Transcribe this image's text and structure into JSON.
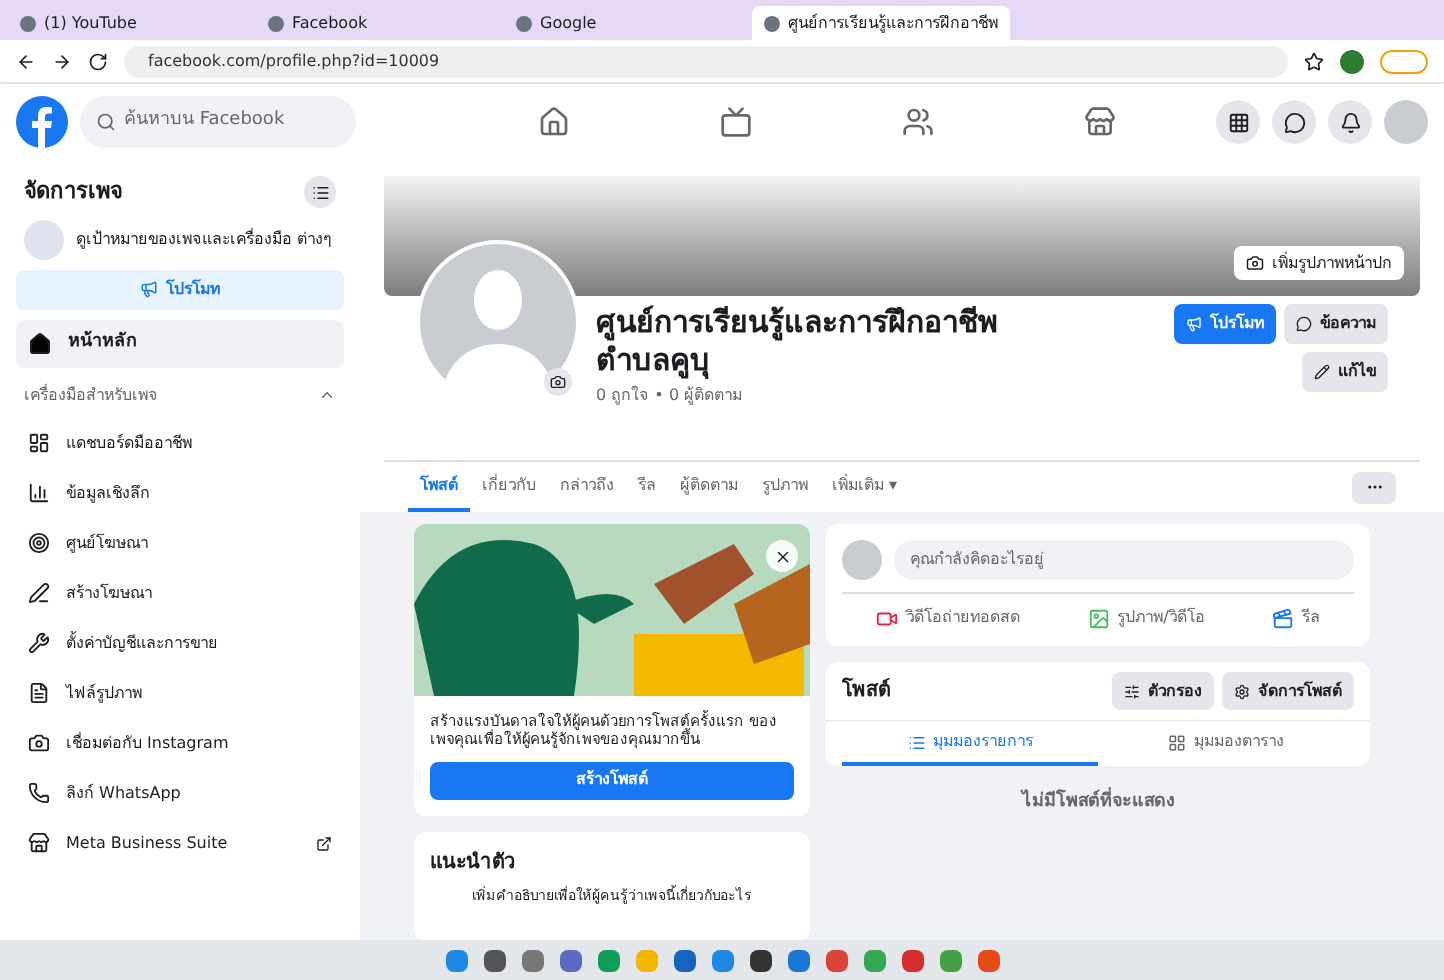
{
  "browser": {
    "tabs": [
      {
        "title": "(1) YouTube",
        "selected": false
      },
      {
        "title": "Facebook",
        "selected": false
      },
      {
        "title": "Google",
        "selected": false
      },
      {
        "title": "ศูนย์การเรียนรู้และการฝึกอาชีพ",
        "selected": true
      }
    ],
    "url": "facebook.com/profile.php?id=10009"
  },
  "fb_header": {
    "search_placeholder": "ค้นหาบน Facebook"
  },
  "sidebar": {
    "title": "จัดการเพจ",
    "page_hint": "ดูเป้าหมายของเพจและเครื่องมือ ต่างๆ",
    "promote_button": "โปรโมท",
    "home": {
      "label": "หน้าหลัก",
      "selected": true
    },
    "section": {
      "title": "เครื่องมือสำหรับเพจ",
      "expanded": true,
      "items": [
        {
          "label": "แดชบอร์ดมืออาชีพ",
          "kind": "dashboard"
        },
        {
          "label": "ข้อมูลเชิงลึก",
          "kind": "insights"
        },
        {
          "label": "ศูนย์โฆษณา",
          "kind": "ads"
        },
        {
          "label": "สร้างโฆษณา",
          "kind": "create"
        },
        {
          "label": "ตั้งค่าบัญชีและการขาย",
          "kind": "tools"
        },
        {
          "label": "ไฟล์รูปภาพ",
          "kind": "files"
        },
        {
          "label": "เชื่อมต่อกับ Instagram",
          "kind": "instagram"
        },
        {
          "label": "ลิงก์ WhatsApp",
          "kind": "whatsapp"
        },
        {
          "label": "Meta Business Suite",
          "kind": "external"
        }
      ]
    }
  },
  "page": {
    "cover_button": "เพิ่มรูปภาพหน้าปก",
    "name": "ศูนย์การเรียนรู้และการฝึกอาชีพ ตำบลคูบุ",
    "stats": "0 ถูกใจ • 0 ผู้ติดตาม",
    "buttons": [
      {
        "label": "โปรโมท",
        "kind": "primary"
      },
      {
        "label": "ข้อความ",
        "kind": "secondary"
      },
      {
        "label": "แก้ไข",
        "kind": "secondary"
      }
    ],
    "tabs": [
      {
        "label": "โพสต์",
        "selected": true
      },
      {
        "label": "เกี่ยวกับ",
        "selected": false
      },
      {
        "label": "กล่าวถึง",
        "selected": false
      },
      {
        "label": "รีล",
        "selected": false
      },
      {
        "label": "ผู้ติดตาม",
        "selected": false
      },
      {
        "label": "รูปภาพ",
        "selected": false
      },
      {
        "label": "เพิ่มเติม ▾",
        "selected": false
      }
    ]
  },
  "intro_card": {
    "text": "สร้างแรงบันดาลใจให้ผู้คนด้วยการโพสต์ครั้งแรก ของเพจคุณเพื่อให้ผู้คนรู้จักเพจของคุณมากขึ้น",
    "button": "สร้างโพสต์"
  },
  "about_card": {
    "title": "แนะนำตัว",
    "text": "เพิ่มคำอธิบายเพื่อให้ผู้คนรู้ว่าเพจนี้เกี่ยวกับอะไร"
  },
  "composer": {
    "placeholder": "คุณกำลังคิดอะไรอยู่",
    "actions": [
      {
        "label": "วิดีโอถ่ายทอดสด",
        "kind": "live"
      },
      {
        "label": "รูปภาพ/วิดีโอ",
        "kind": "photo"
      },
      {
        "label": "รีล",
        "kind": "reel"
      }
    ]
  },
  "posts": {
    "title": "โพสต์",
    "buttons": [
      {
        "label": "ตัวกรอง",
        "kind": "filter"
      },
      {
        "label": "จัดการโพสต์",
        "kind": "manage"
      }
    ],
    "views": [
      {
        "label": "มุมมองรายการ",
        "selected": true
      },
      {
        "label": "มุมมองตาราง",
        "selected": false
      }
    ],
    "empty_text": "ไม่มีโพสต์ที่จะแสดง"
  }
}
